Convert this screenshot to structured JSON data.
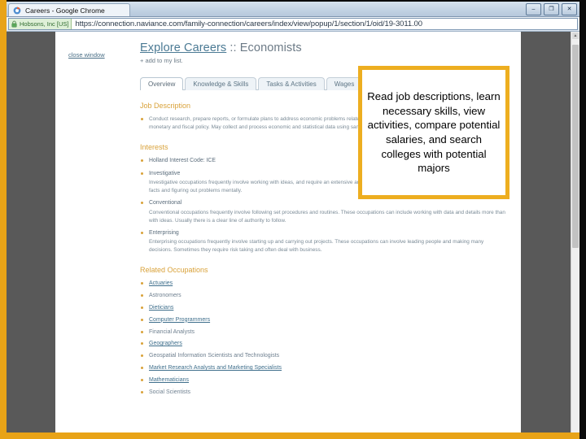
{
  "window": {
    "tab_title": "Careers - Google Chrome",
    "favicon": "chrome-favicon-icon",
    "minimize_label": "–",
    "maximize_label": "❐",
    "close_label": "✕"
  },
  "address_bar": {
    "lock_icon": "lock-icon",
    "ev_certificate": "Hobsons, Inc [US]",
    "url": "https://connection.naviance.com/family-connection/careers/index/view/popup/1/section/1/oid/19-3011.00"
  },
  "page": {
    "close_window_link": "close window",
    "title_link": "Explore Careers",
    "title_separator": " :: ",
    "title_subject": "Economists",
    "add_to_list": "+ add to my list.",
    "tabs": [
      {
        "label": "Overview",
        "active": true
      },
      {
        "label": "Knowledge & Skills",
        "active": false
      },
      {
        "label": "Tasks & Activities",
        "active": false
      },
      {
        "label": "Wages",
        "active": false
      }
    ],
    "job_description": {
      "heading": "Job Description",
      "text": "Conduct research, prepare reports, or formulate plans to address economic problems related to the production and distribution of goods and services or monetary and fiscal policy. May collect and process economic and statistical data using sampling techniques and econometric methods."
    },
    "interests": {
      "heading": "Interests",
      "holland_code": "Holland Interest Code: ICE",
      "items": [
        {
          "title": "Investigative",
          "body": "Investigative occupations frequently involve working with ideas, and require an extensive amount of thinking. These occupations can involve searching for facts and figuring out problems mentally."
        },
        {
          "title": "Conventional",
          "body": "Conventional occupations frequently involve following set procedures and routines. These occupations can include working with data and details more than with ideas. Usually there is a clear line of authority to follow."
        },
        {
          "title": "Enterprising",
          "body": "Enterprising occupations frequently involve starting up and carrying out projects. These occupations can involve leading people and making many decisions. Sometimes they require risk taking and often deal with business."
        }
      ]
    },
    "related_occupations": {
      "heading": "Related Occupations",
      "items": [
        {
          "label": "Actuaries",
          "link": true
        },
        {
          "label": "Astronomers",
          "link": false
        },
        {
          "label": "Dieticians",
          "link": true
        },
        {
          "label": "Computer Programmers",
          "link": true
        },
        {
          "label": "Financial Analysts",
          "link": false
        },
        {
          "label": "Geographers",
          "link": true
        },
        {
          "label": "Geospatial Information Scientists and Technologists",
          "link": false
        },
        {
          "label": "Market Research Analysts and Marketing Specialists",
          "link": true
        },
        {
          "label": "Mathematicians",
          "link": true
        },
        {
          "label": "Social Scientists",
          "link": false
        }
      ]
    }
  },
  "callout": {
    "text": "Read job descriptions, learn necessary skills, view activities, compare potential salaries, and search colleges with potential majors",
    "border_color": "#EDAE20"
  },
  "frame": {
    "accent_color": "#E8A317"
  }
}
